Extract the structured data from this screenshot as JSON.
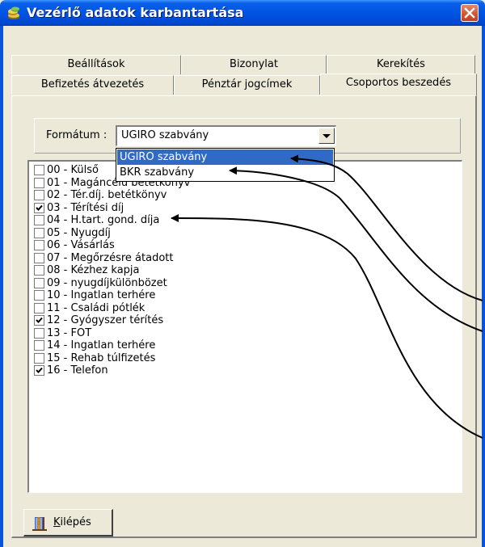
{
  "window": {
    "title": "Vezérlő adatok karbantartása"
  },
  "tabs": {
    "row1": [
      "Beállítások",
      "Bizonylat",
      "Kerekítés"
    ],
    "row2": [
      "Befizetés átvezetés",
      "Pénztár jogcímek",
      "Csoportos beszedés"
    ],
    "active": "Csoportos beszedés"
  },
  "format": {
    "label": "Formátum :",
    "value": "UGIRO szabvány",
    "options": [
      "UGIRO szabvány",
      "BKR szabvány"
    ],
    "highlighted": "UGIRO szabvány"
  },
  "list": {
    "items": [
      {
        "label": "00 - Külső",
        "checked": false
      },
      {
        "label": "01 - Magáncélú betétkönyv",
        "checked": false
      },
      {
        "label": "02 - Tér.díj. betétkönyv",
        "checked": false
      },
      {
        "label": "03 - Térítési díj",
        "checked": true
      },
      {
        "label": "04 - H.tart. gond. díja",
        "checked": false
      },
      {
        "label": "05 - Nyugdíj",
        "checked": false
      },
      {
        "label": "06 - Vásárlás",
        "checked": false
      },
      {
        "label": "07 - Megőrzésre átadott",
        "checked": false
      },
      {
        "label": "08 - Kézhez kapja",
        "checked": false
      },
      {
        "label": "09 - nyugdíjkülönbözet",
        "checked": false
      },
      {
        "label": "10 - Ingatlan terhére",
        "checked": false
      },
      {
        "label": "11 - Családi pótlék",
        "checked": false
      },
      {
        "label": "12 - Gyógyszer térítés",
        "checked": true
      },
      {
        "label": "13 - FOT",
        "checked": false
      },
      {
        "label": "14 - Ingatlan terhére",
        "checked": false
      },
      {
        "label": "15 - Rehab túlfizetés",
        "checked": false
      },
      {
        "label": "16 - Telefon",
        "checked": true
      }
    ]
  },
  "exit_button": {
    "hotkey": "K",
    "rest": "ilépés"
  },
  "colors": {
    "titlebar": "#0054E3",
    "selection": "#316AC5",
    "window_bg": "#ECE9D8",
    "close": "#D6512E"
  }
}
